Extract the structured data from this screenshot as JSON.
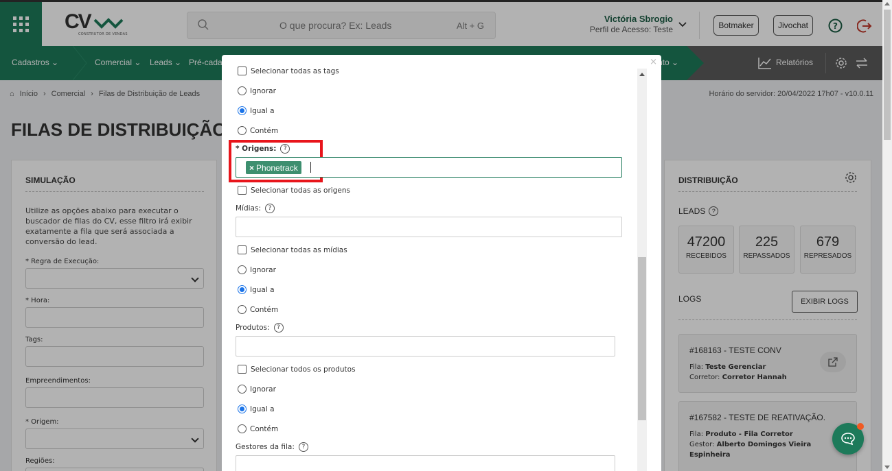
{
  "header": {
    "logo_text": "CV",
    "logo_subtitle": "CONSTRUTOR DE VENDAS",
    "search_placeholder": "O que procura? Ex: Leads",
    "search_shortcut": "Alt + G",
    "user_name": "Victória Sbrogio",
    "user_profile": "Perfil de Acesso: Teste",
    "botmaker_label": "Botmaker",
    "jivochat_label": "Jivochat",
    "colors": {
      "brand_green": "#1d7a5a",
      "logout_red": "#c0392b"
    }
  },
  "nav": {
    "items": [
      {
        "label": "Cadastros"
      },
      {
        "label": "Comercial"
      },
      {
        "label": "Leads"
      },
      {
        "label": "Pré-cada"
      },
      {
        "label": "nto"
      }
    ],
    "reports_label": "Relatórios"
  },
  "breadcrumb": {
    "items": [
      "Início",
      "Comercial",
      "Filas de Distribuição de Leads"
    ],
    "server_time": "Horário do servidor: 20/04/2022 17h07 - v10.0.11"
  },
  "page": {
    "title": "FILAS DE DISTRIBUIÇÃO D"
  },
  "simulation": {
    "title": "SIMULAÇÃO",
    "description": "Utilize as opções abaixo para executar o buscador de filas do CV, esse filtro irá exibir exatamente a fila que será associada a conversão do lead.",
    "fields": [
      {
        "label": "* Regra de Execução:"
      },
      {
        "label": "* Hora:"
      },
      {
        "label": "Tags:"
      },
      {
        "label": "Empreendimentos:"
      },
      {
        "label": "* Origem:"
      },
      {
        "label": "Regiões:"
      }
    ]
  },
  "distribution": {
    "title": "DISTRIBUIÇÃO",
    "leads_label": "LEADS",
    "stats": [
      {
        "value": "47200",
        "label": "RECEBIDOS"
      },
      {
        "value": "225",
        "label": "REPASSADOS"
      },
      {
        "value": "679",
        "label": "REPRESADOS"
      }
    ],
    "logs_label": "LOGS",
    "logs_button": "EXIBIR LOGS",
    "logs": [
      {
        "title": "#168163 - TESTE CONV",
        "line1_key": "Fila:",
        "line1_val": "Teste Gerenciar",
        "line2_key": "Corretor:",
        "line2_val": "Corretor Hannah"
      },
      {
        "title": "#167582 - TESTE DE REATIVAÇÃO.",
        "line1_key": "Fila:",
        "line1_val": "Produto - Fila Corretor",
        "line2_key": "Gestor:",
        "line2_val": "Alberto Domingos Vieira",
        "line3_val": "Espinheira"
      }
    ]
  },
  "modal": {
    "close": "×",
    "select_all_tags": "Selecionar todas as tags",
    "radio_ignore": "Ignorar",
    "radio_equal": "Igual a",
    "radio_contains": "Contém",
    "origens_label": "* Origens:",
    "origens_tag": "Phonetrack",
    "select_all_origens": "Selecionar todas as origens",
    "midias_label": "Mídias:",
    "select_all_midias": "Selecionar todas as mídias",
    "produtos_label": "Produtos:",
    "select_all_produtos": "Selecionar todos os produtos",
    "gestores_label": "Gestores da fila:",
    "help_mark": "?"
  }
}
